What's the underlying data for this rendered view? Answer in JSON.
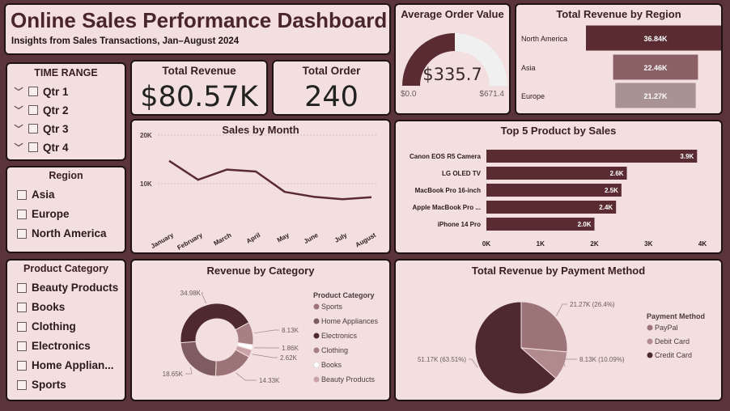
{
  "header": {
    "title": "Online Sales Performance Dashboard",
    "subtitle": "Insights from Sales Transactions, Jan–August 2024"
  },
  "kpi": {
    "aov_title": "Average Order Value",
    "aov_value": "$335.7",
    "aov_min": "$0.0",
    "aov_max": "$671.4",
    "aov_fraction": 0.5,
    "revenue_title": "Total Revenue",
    "revenue_value": "$80.57K",
    "orders_title": "Total Order",
    "orders_value": "240"
  },
  "slicers": {
    "time": {
      "title": "TIME RANGE",
      "items": [
        "Qtr 1",
        "Qtr 2",
        "Qtr 3",
        "Qtr 4"
      ]
    },
    "region": {
      "title": "Region",
      "items": [
        "Asia",
        "Europe",
        "North America"
      ]
    },
    "category": {
      "title": "Product Category",
      "items": [
        "Beauty Products",
        "Books",
        "Clothing",
        "Electronics",
        "Home Applian...",
        "Sports"
      ]
    }
  },
  "colors": {
    "primary": "#5a2b30",
    "mid": "#8a6064",
    "light": "#a89294",
    "card": "#f3dfe0"
  },
  "chart_data": [
    {
      "id": "region",
      "type": "bar",
      "title": "Total Revenue by Region",
      "categories": [
        "North America",
        "Asia",
        "Europe"
      ],
      "values": [
        36.84,
        22.46,
        21.27
      ],
      "labels": [
        "36.84K",
        "22.46K",
        "21.27K"
      ]
    },
    {
      "id": "month",
      "type": "line",
      "title": "Sales by Month",
      "x": [
        "January",
        "February",
        "March",
        "April",
        "May",
        "June",
        "July",
        "August"
      ],
      "values": [
        14700,
        10800,
        12900,
        12500,
        8300,
        7300,
        6800,
        7200
      ],
      "ylim": [
        0,
        25000
      ],
      "yticks": [
        "20K",
        "10K"
      ],
      "ytick_values": [
        20000,
        10000
      ]
    },
    {
      "id": "products",
      "type": "bar",
      "title": "Top 5 Product by Sales",
      "categories": [
        "Canon EOS R5 Camera",
        "LG OLED TV",
        "MacBook Pro 16-inch",
        "Apple MacBook Pro ...",
        "iPhone 14 Pro"
      ],
      "values": [
        3.9,
        2.6,
        2.5,
        2.4,
        2.0
      ],
      "labels": [
        "3.9K",
        "2.6K",
        "2.5K",
        "2.4K",
        "2.0K"
      ],
      "xticks": [
        "0K",
        "1K",
        "2K",
        "3K",
        "4K"
      ],
      "xlim": [
        0,
        4
      ]
    },
    {
      "id": "category",
      "type": "pie",
      "title": "Revenue by Category",
      "legend_title": "Product Category",
      "categories": [
        "Sports",
        "Home Appliances",
        "Electronics",
        "Clothing",
        "Books",
        "Beauty Products"
      ],
      "values": [
        14.33,
        18.65,
        34.98,
        8.13,
        1.86,
        2.62
      ],
      "labels": [
        "14.33K",
        "18.65K",
        "34.98K",
        "8.13K",
        "1.86K",
        "2.62K"
      ],
      "colors": [
        "#9c7477",
        "#7e5c60",
        "#4e2a2f",
        "#a87f83",
        "#ffffff",
        "#c9a3a6"
      ]
    },
    {
      "id": "payment",
      "type": "pie",
      "title": "Total Revenue by Payment Method",
      "legend_title": "Payment Method",
      "categories": [
        "PayPal",
        "Debit Card",
        "Credit Card"
      ],
      "values": [
        21.27,
        8.13,
        51.17
      ],
      "labels": [
        "21.27K (26.4%)",
        "8.13K (10.09%)",
        "51.17K (63.51%)"
      ],
      "colors": [
        "#9c7477",
        "#b08a8d",
        "#4e2a2f"
      ]
    }
  ]
}
